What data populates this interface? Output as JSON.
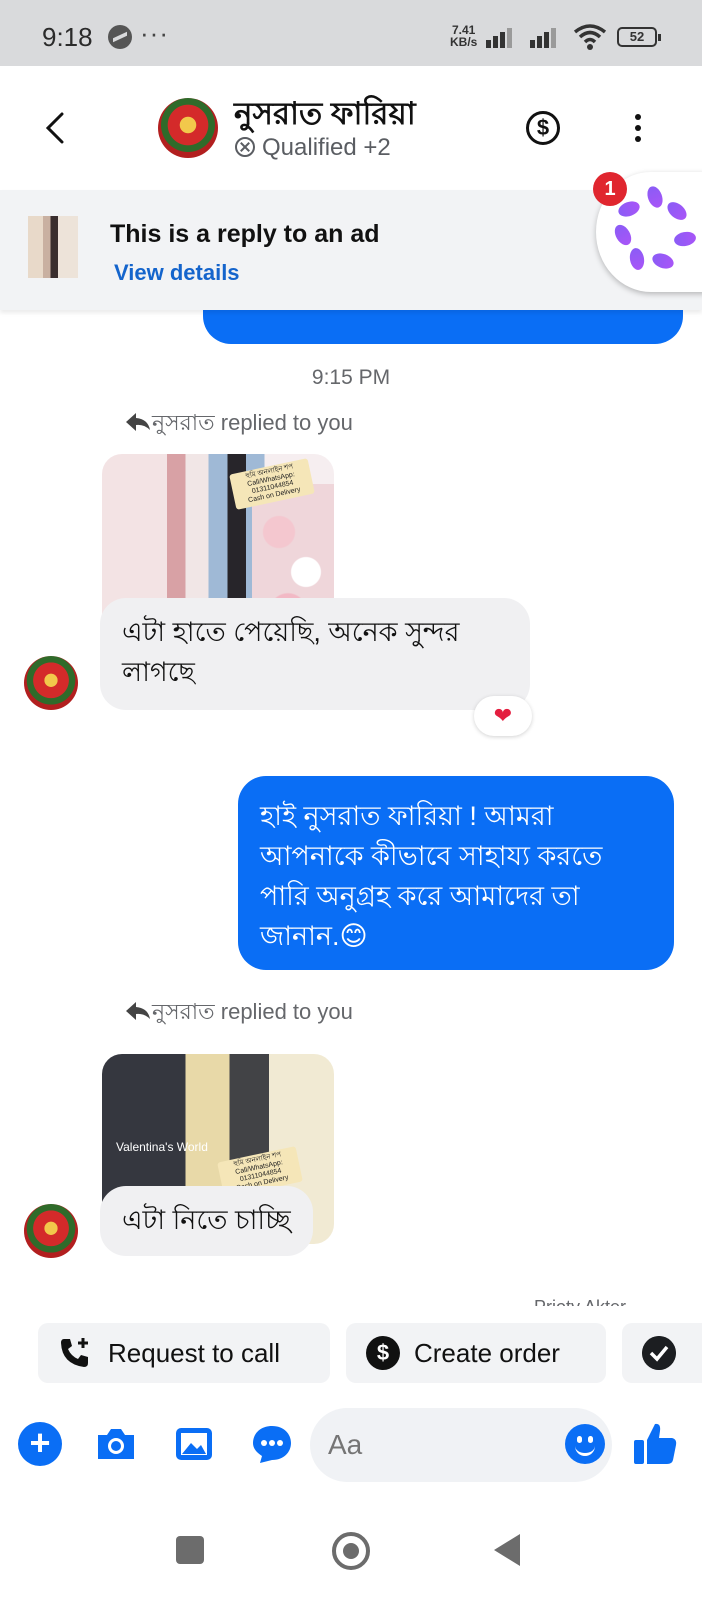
{
  "status_bar": {
    "time": "9:18",
    "overflow": "···",
    "speed_value": "7.41",
    "speed_unit": "KB/s",
    "battery": "52"
  },
  "header": {
    "contact_name": "নুসরাত ফারিয়া",
    "tag_label": "Qualified +2",
    "dollar_icon": "$"
  },
  "ad_banner": {
    "title": "This is a reply to an ad",
    "link": "View details",
    "chat_head_badge": "1"
  },
  "chat": {
    "timestamp": "9:15 PM",
    "messages": [
      {
        "replied_label": "নুসরাত replied to you",
        "image_label_lines": [
          "হুমি অনলাইন শপ",
          "Call/WhatsApp:",
          "01311044854",
          "Cash on Delivery"
        ],
        "text": "এটা হাতে পেয়েছি, অনেক সুন্দর লাগছে",
        "reaction": "❤"
      },
      {
        "text": "হাই নুসরাত ফারিয়া ! আমরা আপনাকে কীভাবে সাহায্য করতে পারি অনুগ্রহ করে আমাদের তা জানান.😊"
      },
      {
        "replied_label": "নুসরাত replied to you",
        "image_watermark": "Valentina's World",
        "image_label_lines": [
          "হুমি অনলাইন শপ",
          "Call/WhatsApp:",
          "01311044854",
          "Cash on Delivery"
        ],
        "text": "এটা নিতে চাচ্ছি"
      }
    ],
    "seen_partial": "Prioty Akter"
  },
  "quick_actions": {
    "request_call": "Request to call",
    "create_order": "Create order",
    "create_order_icon": "$"
  },
  "composer": {
    "placeholder": "Aa",
    "plus": "+"
  },
  "colors": {
    "messenger_blue": "#0a6ef5",
    "incoming_bubble": "#f0f0f2",
    "link_blue": "#1464cc"
  }
}
